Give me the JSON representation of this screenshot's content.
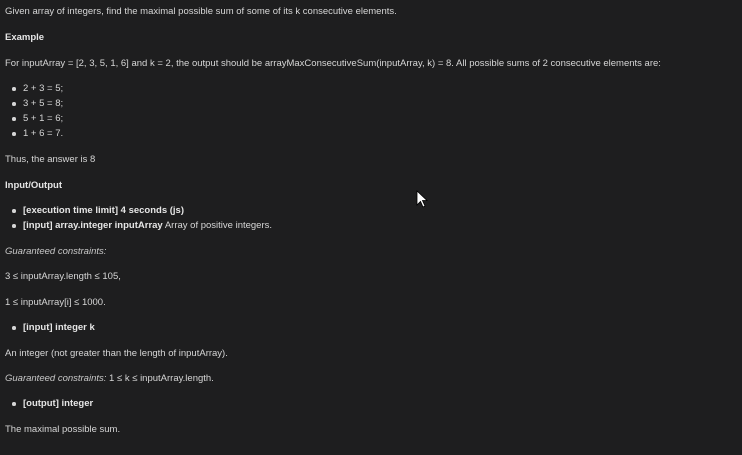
{
  "problem": {
    "intro": "Given array of integers, find the maximal possible sum of some of its k consecutive elements.",
    "example_heading": "Example",
    "example_text": "For inputArray = [2, 3, 5, 1, 6] and k = 2, the output should be arrayMaxConsecutiveSum(inputArray, k) = 8. All possible sums of 2 consecutive elements are:",
    "sums": [
      "2 + 3 = 5;",
      "3 + 5 = 8;",
      "5 + 1 = 6;",
      "1 + 6 = 7."
    ],
    "answer": "Thus, the answer is 8",
    "io_heading": "Input/Output",
    "time_limit": "[execution time limit] 4 seconds (js)",
    "input_array_label": "[input] array.integer inputArray",
    "input_array_desc": "Array of positive integers.",
    "constraints_label": "Guaranteed constraints:",
    "constraint_length": "3 ≤ inputArray.length ≤ 105,",
    "constraint_values": "1 ≤ inputArray[i] ≤ 1000.",
    "input_k_label": "[input] integer k",
    "k_desc": "An integer (not greater than the length of inputArray).",
    "k_constraint_label": "Guaranteed constraints:",
    "k_constraint": "1 ≤ k ≤ inputArray.length.",
    "output_label": "[output] integer",
    "output_desc": "The maximal possible sum."
  },
  "cursor_icon": "mouse-pointer-icon"
}
